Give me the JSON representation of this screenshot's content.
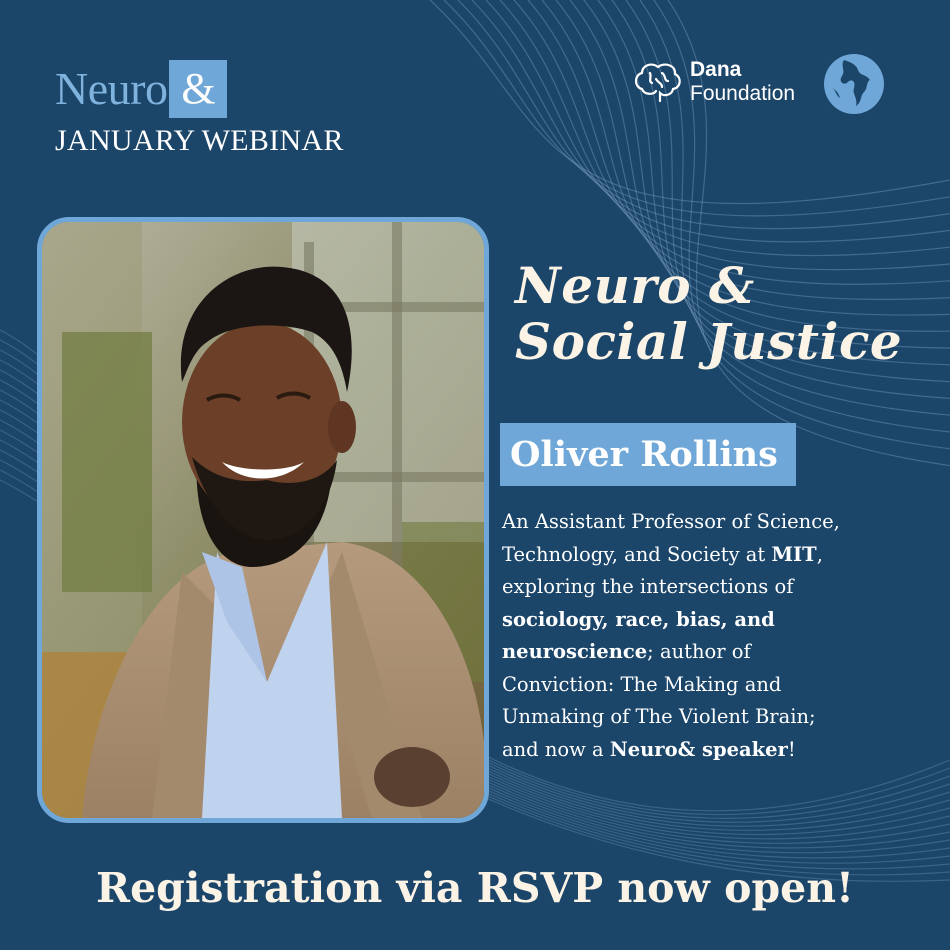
{
  "header": {
    "brand_word": "Neuro",
    "brand_amp": "&",
    "subtitle": "JANUARY WEBINAR"
  },
  "partner": {
    "line1": "Dana",
    "line2": "Foundation",
    "icons": [
      "brain-icon",
      "globe-icon"
    ]
  },
  "event": {
    "title_line1": "Neuro &",
    "title_line2": "Social Justice"
  },
  "speaker": {
    "name": "Oliver Rollins",
    "bio": {
      "l1": "An Assistant Professor of Science,",
      "l2a": "Technology, and Society at ",
      "l2b": "MIT",
      "l2c": ",",
      "l3": "exploring the intersections of",
      "l4": "sociology, race, bias, and",
      "l5a": "neuroscience",
      "l5b": "; author of",
      "l6": "Conviction: The Making and",
      "l7": "Unmaking of The Violent Brain;",
      "l8a": "and now a ",
      "l8b": "Neuro& speaker",
      "l8c": "!"
    }
  },
  "footer": {
    "cta": "Registration via RSVP now open!"
  },
  "colors": {
    "background": "#1b4569",
    "accent": "#6fa7d8",
    "cream": "#fbf4e6"
  }
}
